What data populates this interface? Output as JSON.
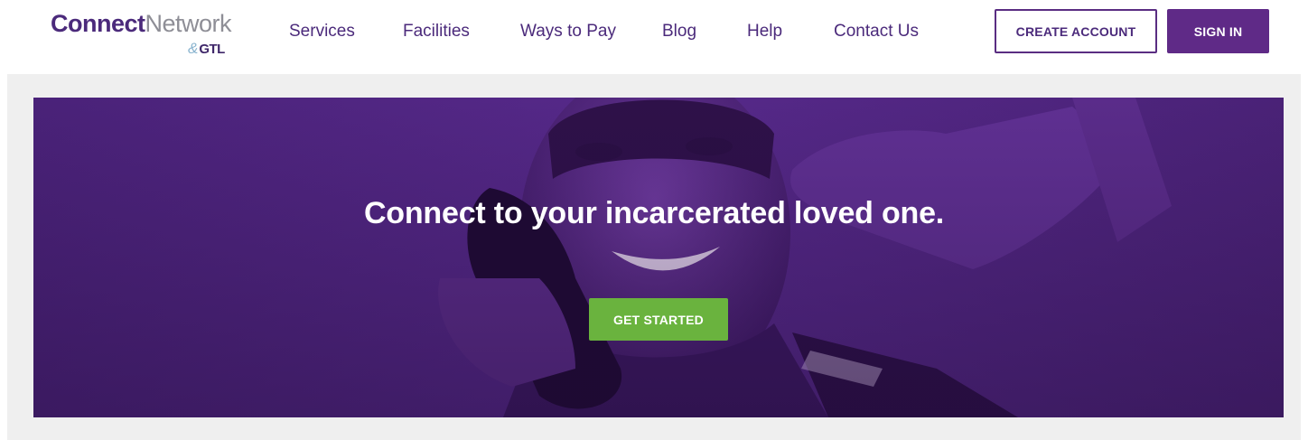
{
  "header": {
    "logo": {
      "connect": "Connect",
      "network": "Network",
      "amp": "&",
      "gtl": "GTL"
    },
    "nav": [
      {
        "label": "Services"
      },
      {
        "label": "Facilities"
      },
      {
        "label": "Ways to Pay"
      },
      {
        "label": "Blog"
      },
      {
        "label": "Help"
      },
      {
        "label": "Contact Us"
      }
    ],
    "create_account_label": "CREATE ACCOUNT",
    "sign_in_label": "SIGN IN"
  },
  "hero": {
    "title": "Connect to your incarcerated loved one.",
    "cta_label": "GET STARTED"
  },
  "colors": {
    "brand_purple": "#5f2a87",
    "hero_purple": "#4e2580",
    "cta_green": "#6ab33e",
    "band_gray": "#efefef"
  }
}
